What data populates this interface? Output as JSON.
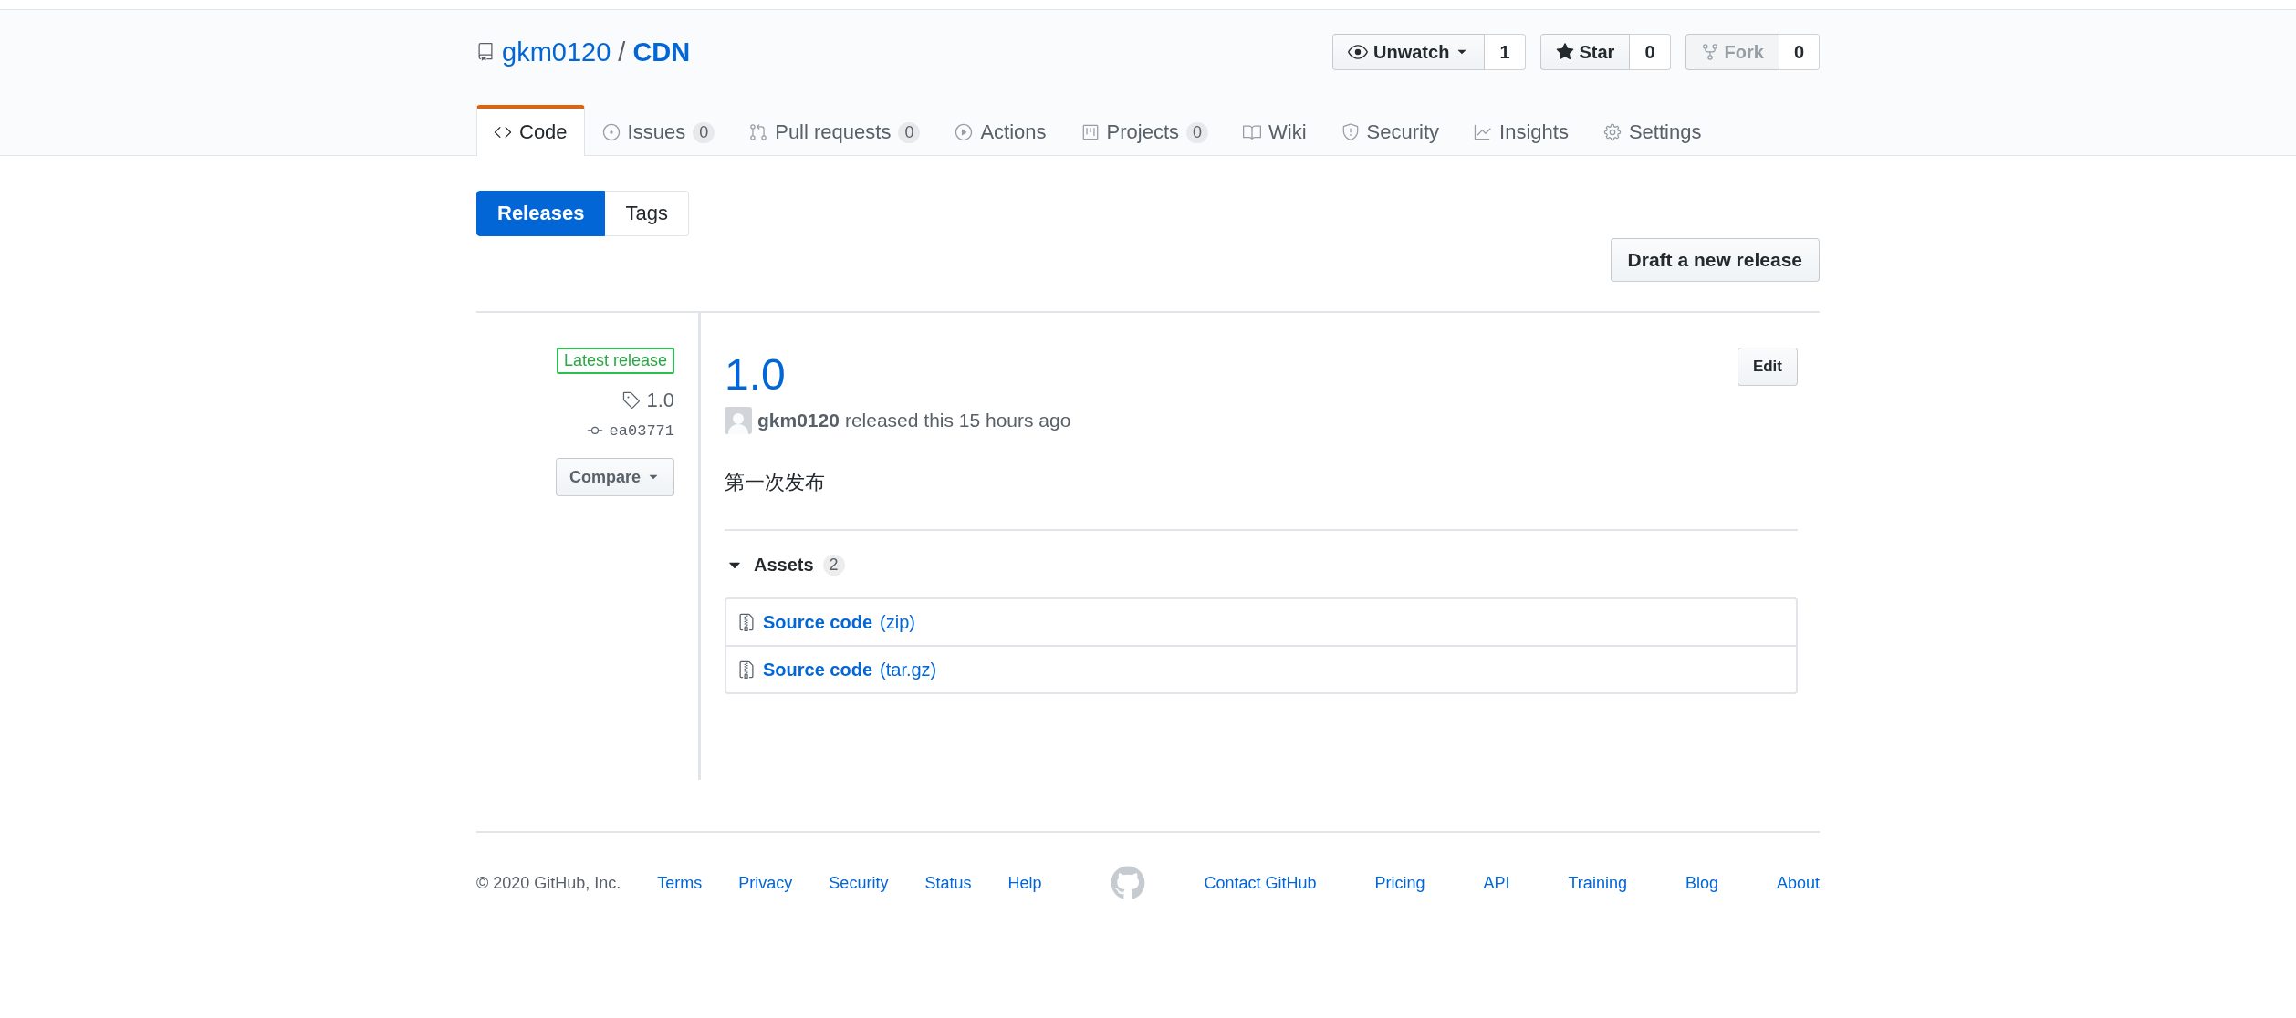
{
  "repo": {
    "owner": "gkm0120",
    "separator": "/",
    "name": "CDN"
  },
  "actions": [
    {
      "kind": "watch",
      "label": "Unwatch",
      "count": "1",
      "disabled": false
    },
    {
      "kind": "star",
      "label": "Star",
      "count": "0",
      "disabled": false
    },
    {
      "kind": "fork",
      "label": "Fork",
      "count": "0",
      "disabled": true
    }
  ],
  "tabs": [
    {
      "kind": "code",
      "label": "Code",
      "selected": true
    },
    {
      "kind": "issues",
      "label": "Issues",
      "count": "0",
      "selected": false
    },
    {
      "kind": "pulls",
      "label": "Pull requests",
      "count": "0",
      "selected": false
    },
    {
      "kind": "actions",
      "label": "Actions",
      "selected": false
    },
    {
      "kind": "projects",
      "label": "Projects",
      "count": "0",
      "selected": false
    },
    {
      "kind": "wiki",
      "label": "Wiki",
      "selected": false
    },
    {
      "kind": "security",
      "label": "Security",
      "selected": false
    },
    {
      "kind": "insights",
      "label": "Insights",
      "selected": false
    },
    {
      "kind": "settings",
      "label": "Settings",
      "selected": false
    }
  ],
  "subnav": [
    {
      "label": "Releases",
      "selected": true
    },
    {
      "label": "Tags",
      "selected": false
    }
  ],
  "draft_button": "Draft a new release",
  "release": {
    "badge": "Latest release",
    "tag": "1.0",
    "commit": "ea03771",
    "compare": "Compare",
    "title": "1.0",
    "edit": "Edit",
    "author": "gkm0120",
    "meta": "released this 15 hours ago",
    "body": "第一次发布",
    "assets": {
      "title": "Assets",
      "count": "2",
      "expanded": true,
      "items": [
        {
          "name": "Source code",
          "ext": "(zip)"
        },
        {
          "name": "Source code",
          "ext": "(tar.gz)"
        }
      ]
    }
  },
  "footer": {
    "copyright": "© 2020 GitHub, Inc.",
    "left_links": [
      "Terms",
      "Privacy",
      "Security",
      "Status",
      "Help"
    ],
    "right_links": [
      "Contact GitHub",
      "Pricing",
      "API",
      "Training",
      "Blog",
      "About"
    ]
  }
}
